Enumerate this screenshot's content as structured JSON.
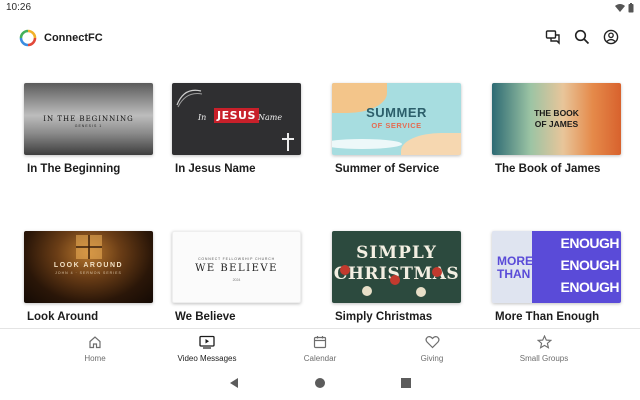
{
  "status": {
    "time": "10:26"
  },
  "app": {
    "title": "ConnectFC"
  },
  "header_actions": [
    "chat-icon",
    "search-icon",
    "account-icon"
  ],
  "videos": [
    {
      "title": "In The Beginning",
      "art_text": "IN THE BEGINNING",
      "art_sub": "GENESIS 1"
    },
    {
      "title": "In Jesus Name",
      "art_in": "In",
      "art_jesus": "JESUS",
      "art_name": "Name"
    },
    {
      "title": "Summer of Service",
      "art_summer": "SUMMER",
      "art_service": "OF SERVICE"
    },
    {
      "title": "The Book of James",
      "art_line1": "THE BOOK",
      "art_line2": "OF JAMES"
    },
    {
      "title": "Look Around",
      "art_text": "LOOK AROUND",
      "art_sub": "JOHN 4 · SERMON SERIES"
    },
    {
      "title": "We Believe",
      "art_church": "CONNECT FELLOWSHIP CHURCH",
      "art_text": "WE BELIEVE",
      "art_year": "2024"
    },
    {
      "title": "Simply Christmas",
      "art_line1": "SIMPLY",
      "art_line2": "CHRISTMAS"
    },
    {
      "title": "More Than Enough",
      "art_more": "MORE",
      "art_than": "THAN",
      "art_enough": "ENOUGH"
    }
  ],
  "bottom_nav": [
    {
      "label": "Home",
      "icon": "home-icon",
      "active": false
    },
    {
      "label": "Video Messages",
      "icon": "video-icon",
      "active": true
    },
    {
      "label": "Calendar",
      "icon": "calendar-icon",
      "active": false
    },
    {
      "label": "Giving",
      "icon": "heart-icon",
      "active": false
    },
    {
      "label": "Small Groups",
      "icon": "star-icon",
      "active": false
    }
  ],
  "colors": {
    "accent_red": "#c8202a",
    "brand_purple": "#5a4bd8",
    "text": "#1c1c1c",
    "muted": "#6d6d6d"
  }
}
